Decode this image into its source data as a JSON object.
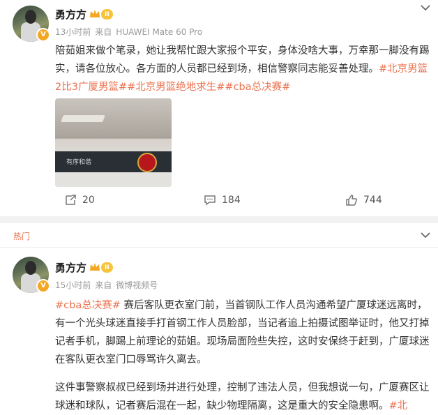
{
  "post1": {
    "username": "勇方方",
    "level": "II",
    "verified": "V",
    "time": "13小时前",
    "source_prefix": "来自",
    "source": "HUAWEI Mate 60 Pro",
    "text": "陪茹姐来做个笔录，她让我帮忙跟大家报个平安，身体没啥大事，万幸那一脚没有踢实，请各位放心。各方面的人员都已经到场，相信警察同志能妥善处理。",
    "tags": [
      "#北京男篮2比3广厦男篮#",
      "#北京男篮绝地求生#",
      "#cba总决赛#"
    ],
    "image_sign_text": "有序和谐",
    "reposts": "20",
    "comments": "184",
    "likes": "744"
  },
  "section_label": "热门",
  "post2": {
    "username": "勇方方",
    "level": "II",
    "verified": "V",
    "time": "15小时前",
    "source_prefix": "来自",
    "source": "微博视频号",
    "tag": "#cba总决赛#",
    "text1": " 赛后客队更衣室门前，当首钢队工作人员沟通希望广厦球迷远离时，有一个光头球迷直接手打首钢工作人员脸部，当记者追上拍摄试图举证时，他又打掉记者手机，脚踢上前理论的茹姐。现场局面险些失控，这时安保终于赶到，广厦球迷在客队更衣室门口辱骂许久离去。",
    "text2": "这件事警察叔叔已经到场并进行处理，控制了违法人员，但我想说一句，广厦赛区让球迷和球队，记者赛后混在一起，缺少物理隔离，这是重大的安全隐患啊。",
    "text2_tag": "#北"
  },
  "colors": {
    "accent": "#eb7350",
    "gold": "#f5a623"
  }
}
